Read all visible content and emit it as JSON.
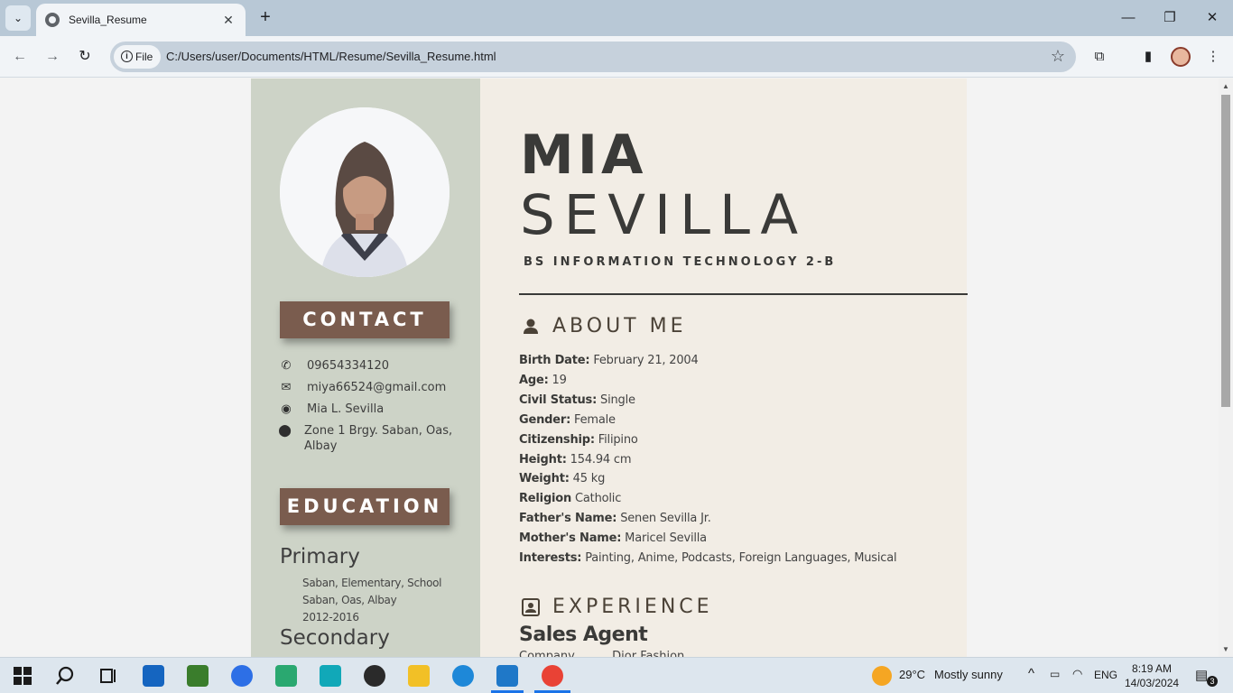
{
  "browser": {
    "tab_title": "Sevilla_Resume",
    "url_chip": "File",
    "url": "C:/Users/user/Documents/HTML/Resume/Sevilla_Resume.html",
    "icons": [
      "tab-search-icon",
      "globe-icon",
      "close-icon",
      "plus-icon",
      "minimize-icon",
      "restore-icon",
      "close-window-icon",
      "back-icon",
      "forward-icon",
      "reload-icon",
      "info-icon",
      "star-icon",
      "extensions-icon",
      "side-panel-icon",
      "profile-icon",
      "menu-icon"
    ]
  },
  "resume": {
    "first_name": "MIA",
    "last_name": "SEVILLA",
    "course": "BS INFORMATION TECHNOLOGY 2-B",
    "contact_title": "CONTACT",
    "contact": [
      {
        "icon": "phone-icon",
        "text": "09654334120"
      },
      {
        "icon": "mail-icon",
        "text": "miya66524@gmail.com"
      },
      {
        "icon": "messenger-icon",
        "text": "Mia L. Sevilla"
      },
      {
        "icon": "location-icon",
        "text": "Zone 1 Brgy. Saban, Oas, Albay"
      }
    ],
    "education_title": "EDUCATION",
    "education": {
      "primary_label": "Primary",
      "primary_school": "Saban, Elementary, School",
      "primary_place": "Saban, Oas, Albay",
      "primary_years": "2012-2016",
      "secondary_label": "Secondary"
    },
    "about_title": "ABOUT ME",
    "about": {
      "birth_label": "Birth Date:",
      "birth": "February 21, 2004",
      "age_label": "Age:",
      "age": "19",
      "civil_label": "Civil Status:",
      "civil": "Single",
      "gender_label": "Gender:",
      "gender": "Female",
      "citizen_label": "Citizenship:",
      "citizen": "Filipino",
      "height_label": "Height:",
      "height": "154.94 cm",
      "weight_label": "Weight:",
      "weight": "45 kg",
      "religion_label": "Religion",
      "religion": "Catholic",
      "father_label": "Father's Name:",
      "father": "Senen Sevilla Jr.",
      "mother_label": "Mother's Name:",
      "mother": "Maricel Sevilla",
      "interests_label": "Interests:",
      "interests": "Painting, Anime, Podcasts, Foreign Languages, Musical"
    },
    "experience_title": "EXPERIENCE",
    "job_title": "Sales Agent",
    "job_sub": "Company ..., ... Dior Fashion"
  },
  "taskbar": {
    "weather_temp": "29°C",
    "weather_text": "Mostly sunny",
    "lang": "ENG",
    "time": "8:19 AM",
    "date": "14/03/2024",
    "notif_count": "3"
  },
  "colors": {
    "sidebar_bg": "#cdd3c7",
    "main_bg": "#f2ede5",
    "section_box": "#7a5c4e",
    "tabbar": "#b8c8d6"
  }
}
